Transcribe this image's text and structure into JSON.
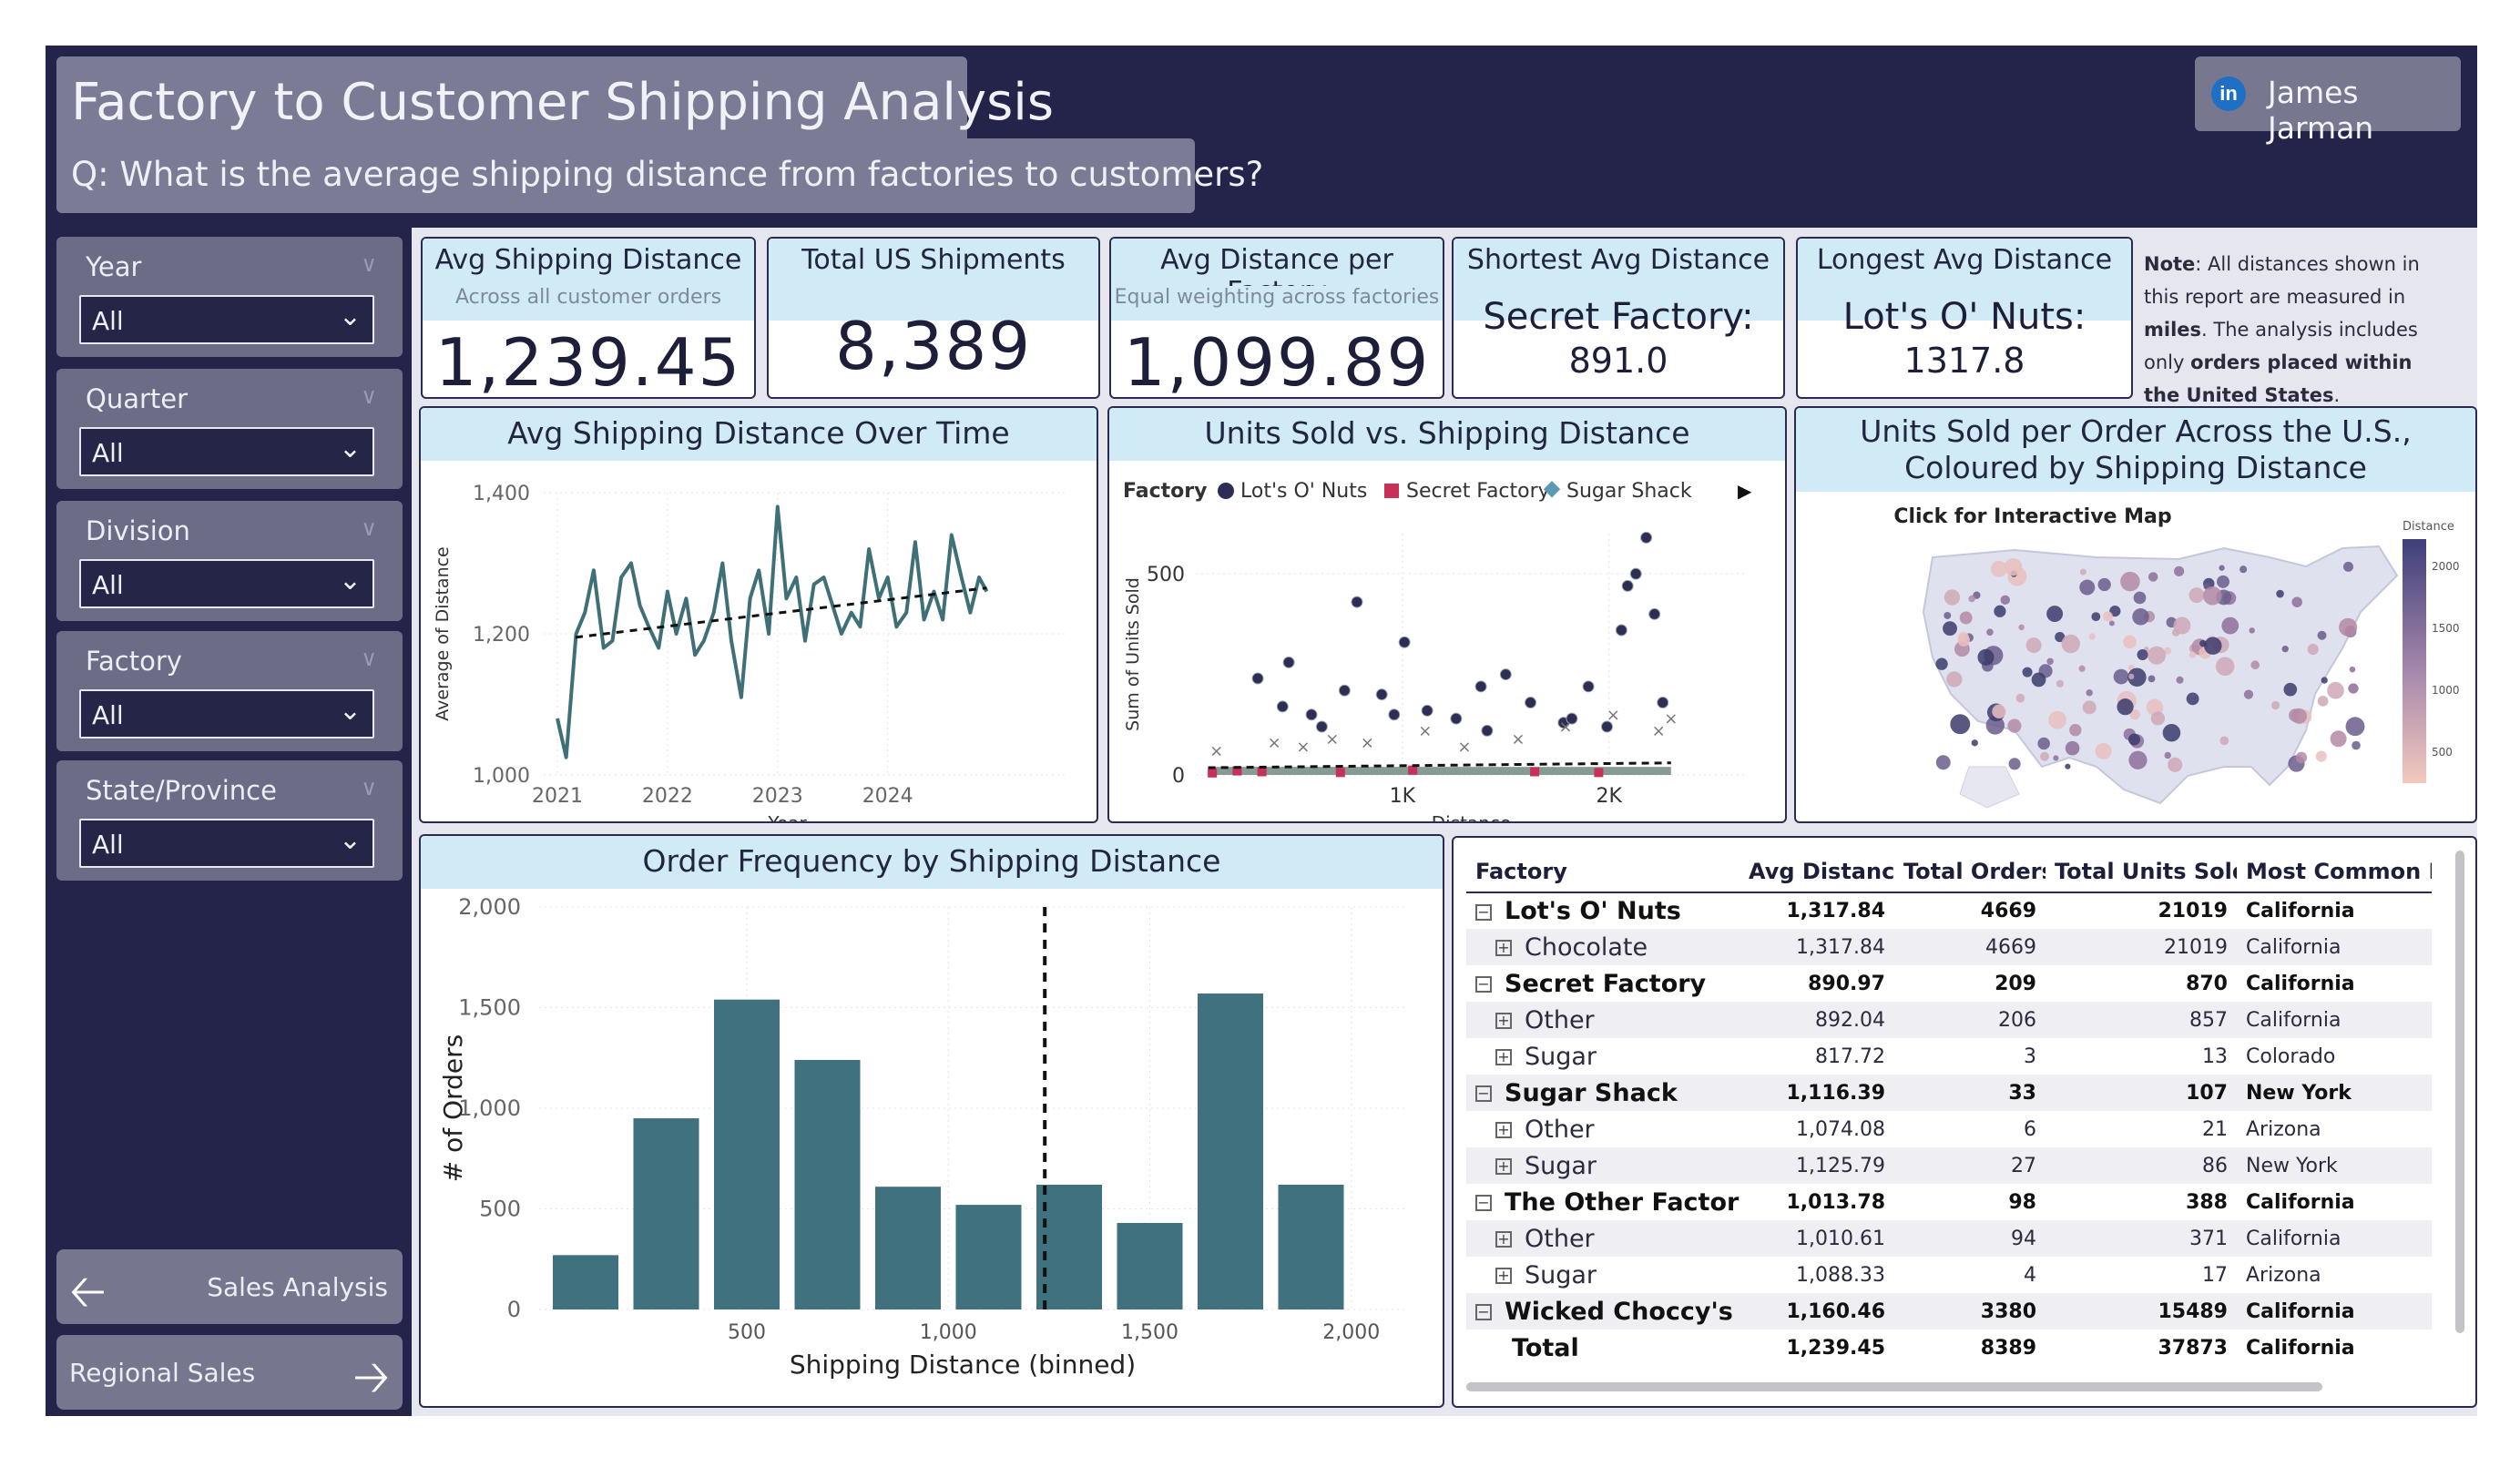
{
  "header": {
    "title": "Factory to Customer Shipping Analysis",
    "subtitle": "Q: What is the average shipping distance from factories to customers?",
    "author_icon": "in",
    "author": "James Jarman"
  },
  "slicers": [
    {
      "title": "Year",
      "value": "All"
    },
    {
      "title": "Quarter",
      "value": "All"
    },
    {
      "title": "Division",
      "value": "All"
    },
    {
      "title": "Factory",
      "value": "All"
    },
    {
      "title": "State/Province",
      "value": "All"
    }
  ],
  "nav": {
    "prev_label": "Sales Analysis",
    "next_label": "Regional Sales"
  },
  "kpis": [
    {
      "title": "Avg Shipping Distance",
      "sub": "Across all customer orders",
      "value": "1,239.45"
    },
    {
      "title": "Total US Shipments",
      "sub": "",
      "value": "8,389"
    },
    {
      "title": "Avg Distance per Factory",
      "sub": "Equal weighting across factories",
      "value": "1,099.89"
    },
    {
      "title": "Shortest Avg Distance",
      "sub": "",
      "line1": "Secret Factory:",
      "line2": "891.0"
    },
    {
      "title": "Longest Avg Distance",
      "sub": "",
      "line1": "Lot's O' Nuts:",
      "line2": "1317.8"
    }
  ],
  "note": {
    "label": "Note",
    "text1": ": All distances shown in this report are measured in ",
    "miles": "miles",
    "text2": ". The analysis includes only ",
    "orders": "orders placed within the United States",
    "text3": "."
  },
  "line_chart": {
    "title": "Avg Shipping Distance Over Time",
    "xlabel": "Year",
    "ylabel": "Average of Distance",
    "xticks": [
      "2021",
      "2022",
      "2023",
      "2024"
    ],
    "yticks": [
      "1,000",
      "1,200",
      "1,400"
    ],
    "color": "#3f7078"
  },
  "scatter_chart": {
    "title": "Units Sold vs. Shipping Distance",
    "legend_title": "Factory",
    "legend": [
      "Lot's O' Nuts",
      "Secret Factory",
      "Sugar Shack"
    ],
    "legend_colors": [
      "#2d2d55",
      "#c8305a",
      "#5b9ab5"
    ],
    "xlabel": "Distance",
    "ylabel": "Sum of Units Sold",
    "xticks": [
      "1K",
      "2K"
    ],
    "yticks": [
      "0",
      "500"
    ]
  },
  "map_card": {
    "title": "Units Sold per Order Across the U.S., Coloured by Shipping Distance",
    "caption": "Click for Interactive Map",
    "legend_title": "Distance",
    "legend_ticks": [
      "2000",
      "1500",
      "1000",
      "500"
    ]
  },
  "chart_data": [
    {
      "type": "line",
      "title": "Avg Shipping Distance Over Time",
      "xlabel": "Year",
      "ylabel": "Average of Distance",
      "xlim": [
        2021,
        2024.9
      ],
      "ylim": [
        1000,
        1400
      ],
      "x": [
        2021.0,
        2021.08,
        2021.17,
        2021.25,
        2021.33,
        2021.42,
        2021.5,
        2021.58,
        2021.67,
        2021.75,
        2021.83,
        2021.92,
        2022.0,
        2022.08,
        2022.17,
        2022.25,
        2022.33,
        2022.42,
        2022.5,
        2022.58,
        2022.67,
        2022.75,
        2022.83,
        2022.92,
        2023.0,
        2023.08,
        2023.17,
        2023.25,
        2023.33,
        2023.42,
        2023.5,
        2023.58,
        2023.67,
        2023.75,
        2023.83,
        2023.92,
        2024.0,
        2024.08,
        2024.17,
        2024.25,
        2024.33,
        2024.42,
        2024.5,
        2024.58,
        2024.67,
        2024.75,
        2024.83,
        2024.9
      ],
      "series": [
        {
          "values": [
            1080,
            1025,
            1200,
            1230,
            1290,
            1180,
            1190,
            1280,
            1300,
            1240,
            1210,
            1180,
            1260,
            1200,
            1250,
            1170,
            1190,
            1230,
            1300,
            1190,
            1110,
            1250,
            1290,
            1200,
            1380,
            1250,
            1280,
            1190,
            1270,
            1280,
            1240,
            1200,
            1230,
            1210,
            1320,
            1250,
            1280,
            1210,
            1230,
            1330,
            1220,
            1260,
            1220,
            1340,
            1280,
            1230,
            1280,
            1260
          ]
        },
        {
          "name": "trend",
          "values": [
            1195,
            1265
          ]
        }
      ]
    },
    {
      "type": "scatter",
      "title": "Units Sold vs. Shipping Distance",
      "xlabel": "Distance",
      "ylabel": "Sum of Units Sold",
      "xlim": [
        0,
        2400
      ],
      "ylim": [
        0,
        600
      ],
      "series": [
        {
          "name": "Lot's O' Nuts",
          "x": [
            300,
            420,
            450,
            560,
            610,
            720,
            780,
            900,
            960,
            1010,
            1120,
            1260,
            1380,
            1410,
            1500,
            1620,
            1780,
            1820,
            1900,
            1990,
            2060,
            2090,
            2130,
            2180,
            2220,
            2260
          ],
          "y": [
            240,
            170,
            280,
            150,
            120,
            210,
            430,
            200,
            150,
            330,
            160,
            140,
            220,
            110,
            250,
            180,
            130,
            140,
            220,
            120,
            360,
            470,
            500,
            590,
            400,
            180
          ]
        },
        {
          "name": "Secret Factory",
          "x": [
            80,
            200,
            320,
            700,
            1050,
            1640,
            1950
          ],
          "y": [
            5,
            10,
            8,
            6,
            12,
            8,
            6
          ]
        },
        {
          "name": "Sugar Shack",
          "x": [
            100,
            380,
            520,
            660,
            830,
            1110,
            1300,
            1560,
            1790,
            2020,
            2240,
            2300
          ],
          "y": [
            60,
            80,
            70,
            90,
            80,
            110,
            70,
            90,
            120,
            150,
            110,
            140
          ]
        }
      ]
    },
    {
      "type": "bar",
      "title": "Order Frequency by Shipping Distance",
      "xlabel": "Shipping Distance (binned)",
      "ylabel": "# of Orders",
      "xticks": [
        "500",
        "1,000",
        "1,500",
        "2,000"
      ],
      "ylim": [
        0,
        2000
      ],
      "categories": [
        "100",
        "300",
        "500",
        "700",
        "900",
        "1100",
        "1300",
        "1500",
        "1700",
        "1900",
        "2100",
        "2300"
      ],
      "values": [
        270,
        950,
        1540,
        1240,
        610,
        520,
        620,
        430,
        0,
        0,
        1570,
        620
      ],
      "reference_line": 1239.45
    }
  ],
  "hist_chart": {
    "title": "Order Frequency by Shipping Distance",
    "xlabel": "Shipping Distance (binned)",
    "ylabel": "# of Orders",
    "xticks": [
      "500",
      "1,000",
      "1,500",
      "2,000"
    ],
    "yticks": [
      "0",
      "500",
      "1,000",
      "1,500",
      "2,000"
    ],
    "bar_color": "#3f717e"
  },
  "table": {
    "headers": [
      "Factory",
      "Avg Distance",
      "Total Orders",
      "Total Units Sold",
      "Most Common De"
    ],
    "rows": [
      {
        "kind": "grp",
        "toggle": "−",
        "name": "Lot's O' Nuts",
        "avg": "1,317.84",
        "orders": "4669",
        "units": "21019",
        "dest": "California"
      },
      {
        "kind": "child",
        "toggle": "+",
        "name": "Chocolate",
        "avg": "1,317.84",
        "orders": "4669",
        "units": "21019",
        "dest": "California"
      },
      {
        "kind": "grp",
        "toggle": "−",
        "name": "Secret Factory",
        "avg": "890.97",
        "orders": "209",
        "units": "870",
        "dest": "California"
      },
      {
        "kind": "child",
        "toggle": "+",
        "name": "Other",
        "avg": "892.04",
        "orders": "206",
        "units": "857",
        "dest": "California"
      },
      {
        "kind": "child",
        "toggle": "+",
        "name": "Sugar",
        "avg": "817.72",
        "orders": "3",
        "units": "13",
        "dest": "Colorado"
      },
      {
        "kind": "grp",
        "toggle": "−",
        "name": "Sugar Shack",
        "avg": "1,116.39",
        "orders": "33",
        "units": "107",
        "dest": "New York"
      },
      {
        "kind": "child",
        "toggle": "+",
        "name": "Other",
        "avg": "1,074.08",
        "orders": "6",
        "units": "21",
        "dest": "Arizona"
      },
      {
        "kind": "child",
        "toggle": "+",
        "name": "Sugar",
        "avg": "1,125.79",
        "orders": "27",
        "units": "86",
        "dest": "New York"
      },
      {
        "kind": "grp",
        "toggle": "−",
        "name": "The Other Factory",
        "avg": "1,013.78",
        "orders": "98",
        "units": "388",
        "dest": "California"
      },
      {
        "kind": "child",
        "toggle": "+",
        "name": "Other",
        "avg": "1,010.61",
        "orders": "94",
        "units": "371",
        "dest": "California"
      },
      {
        "kind": "child",
        "toggle": "+",
        "name": "Sugar",
        "avg": "1,088.33",
        "orders": "4",
        "units": "17",
        "dest": "Arizona"
      },
      {
        "kind": "grp",
        "toggle": "−",
        "name": "Wicked Choccy's",
        "avg": "1,160.46",
        "orders": "3380",
        "units": "15489",
        "dest": "California"
      },
      {
        "kind": "total",
        "toggle": "",
        "name": "Total",
        "avg": "1,239.45",
        "orders": "8389",
        "units": "37873",
        "dest": "California"
      }
    ]
  }
}
